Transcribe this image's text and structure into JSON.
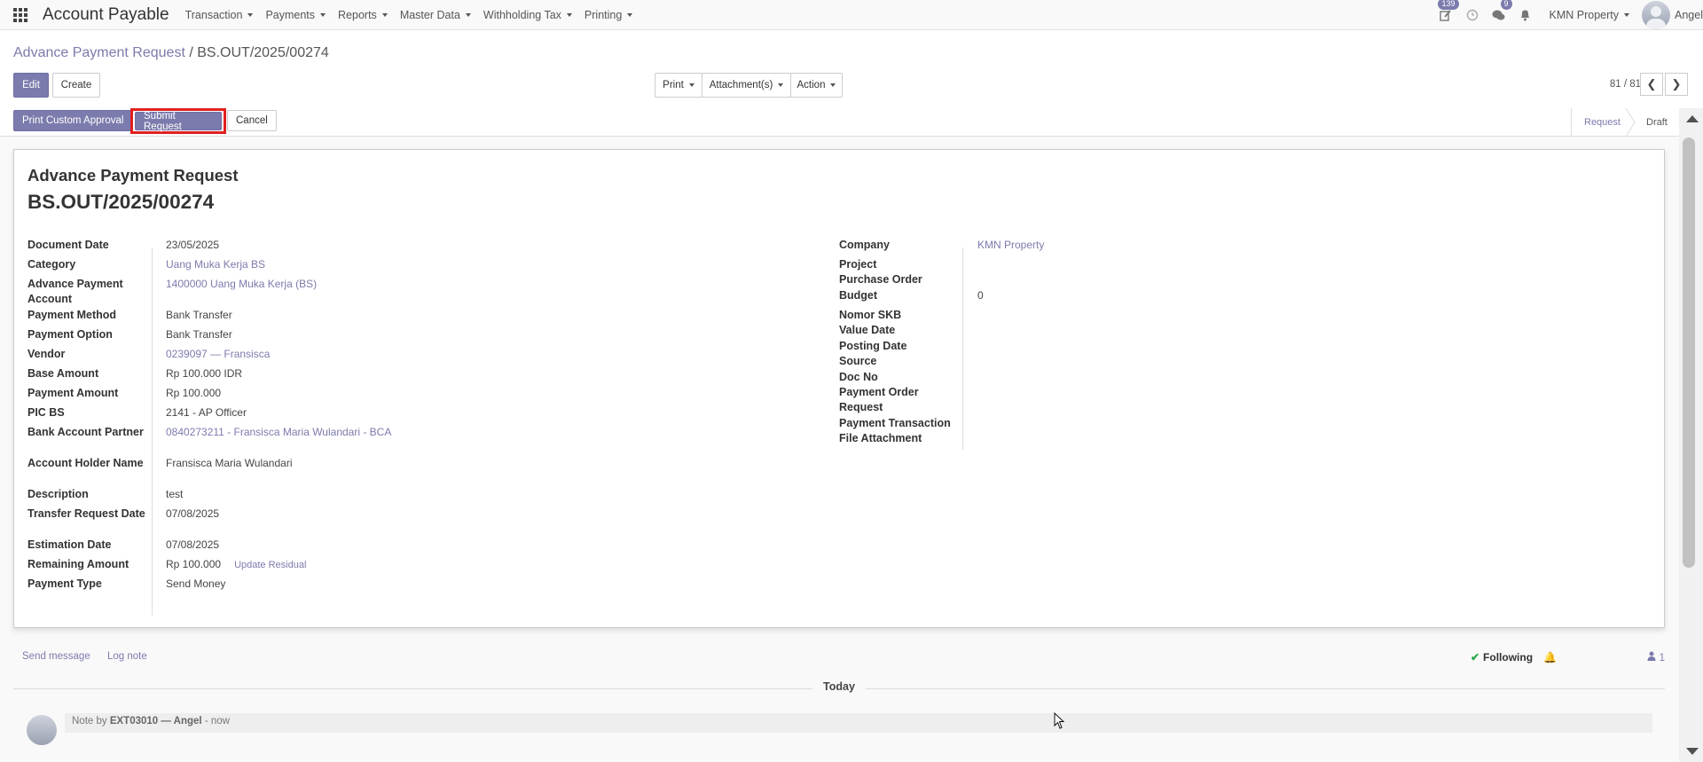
{
  "app": {
    "title": "Account Payable",
    "company": "KMN Property",
    "user": "Angel"
  },
  "menu": [
    "Transaction",
    "Payments",
    "Reports",
    "Master Data",
    "Withholding Tax",
    "Printing"
  ],
  "systray": {
    "activity_badge": "139",
    "messages_badge": "9"
  },
  "breadcrumb": {
    "parent": "Advance Payment Request",
    "separator": "/",
    "current": "BS.OUT/2025/00274"
  },
  "buttons": {
    "edit": "Edit",
    "create": "Create",
    "print": "Print",
    "attachments": "Attachment(s)",
    "action": "Action"
  },
  "pager": {
    "value": "81 / 81"
  },
  "header_buttons": {
    "print_custom": "Print Custom Approval",
    "submit": "Submit Request",
    "cancel": "Cancel"
  },
  "stages": {
    "request": "Request",
    "draft": "Draft"
  },
  "form": {
    "title": "Advance Payment Request",
    "number": "BS.OUT/2025/00274",
    "left": [
      {
        "label": "Document Date",
        "value": "23/05/2025",
        "link": false
      },
      {
        "label": "Category",
        "value": "Uang Muka Kerja BS",
        "link": true
      },
      {
        "label": "Advance Payment Account",
        "value": "1400000 Uang Muka Kerja (BS)",
        "link": true
      },
      {
        "label": "Payment Method",
        "value": "Bank Transfer",
        "link": false
      },
      {
        "label": "Payment Option",
        "value": "Bank Transfer",
        "link": false
      },
      {
        "label": "Vendor",
        "value": "0239097 — Fransisca",
        "link": true
      },
      {
        "label": "Base Amount",
        "value": "Rp 100.000 IDR",
        "link": false
      },
      {
        "label": "Payment Amount",
        "value": "Rp 100.000",
        "link": false
      },
      {
        "label": "PIC BS",
        "value": "2141 - AP Officer",
        "link": false
      },
      {
        "label": "Bank Account Partner",
        "value": "0840273211 - Fransisca Maria Wulandari - BCA",
        "link": true
      },
      {
        "label": "Account Holder Name",
        "value": "Fransisca Maria Wulandari",
        "link": false
      },
      {
        "label": "Description",
        "value": "test",
        "link": false
      },
      {
        "label": "Transfer Request Date",
        "value": "07/08/2025",
        "link": false
      },
      {
        "label": "Estimation Date",
        "value": "07/08/2025",
        "link": false
      },
      {
        "label": "Remaining Amount",
        "value": "Rp 100.000",
        "link": false
      },
      {
        "label": "Payment Type",
        "value": "Send Money",
        "link": false
      }
    ],
    "update_residual": "Update Residual",
    "right": [
      {
        "label": "Company",
        "value": "KMN Property",
        "link": true
      },
      {
        "label": "Project",
        "value": "",
        "link": false
      },
      {
        "label": "Purchase Order",
        "value": "",
        "link": false
      },
      {
        "label": "Budget",
        "value": "0",
        "link": false
      },
      {
        "label": "Nomor SKB",
        "value": "",
        "link": false
      },
      {
        "label": "Value Date",
        "value": "",
        "link": false
      },
      {
        "label": "Posting Date",
        "value": "",
        "link": false
      },
      {
        "label": "Source",
        "value": "",
        "link": false
      },
      {
        "label": "Doc No",
        "value": "",
        "link": false
      },
      {
        "label": "Payment Order Request",
        "value": "",
        "link": false
      },
      {
        "label": "Payment Transaction",
        "value": "",
        "link": false
      },
      {
        "label": "File Attachment",
        "value": "",
        "link": false
      }
    ]
  },
  "chatter": {
    "send_message": "Send message",
    "log_note": "Log note",
    "following": "Following",
    "followers": "1",
    "today": "Today",
    "note_prefix": "Note by",
    "note_author": "EXT03010 — Angel",
    "note_time": "- now"
  },
  "colors": {
    "accent": "#7c7bad",
    "highlight_border": "#e02020"
  }
}
